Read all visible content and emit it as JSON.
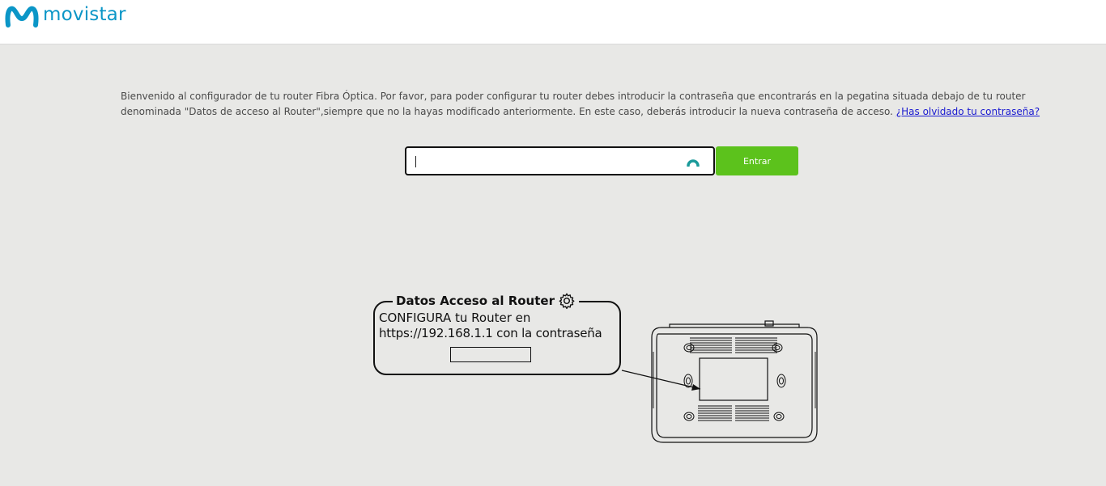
{
  "header": {
    "brand": "movistar",
    "brand_color": "#0b96c7"
  },
  "intro": {
    "text": "Bienvenido al configurador de tu router Fibra Óptica. Por favor, para poder configurar tu router debes introducir la contraseña que encontrarás en la pegatina situada debajo de tu router denominada \"Datos de acceso al Router\",siempre que no la hayas modificado anteriormente. En este caso, deberás introducir la nueva contraseña de acceso.",
    "forgot_link": "¿Has olvidado tu contraseña?"
  },
  "login": {
    "password_value": "",
    "submit_label": "Entrar",
    "submit_color": "#5cc21c"
  },
  "sticker": {
    "title": "Datos Acceso al Router",
    "line1": "CONFIGURA tu Router en",
    "line2": "https://192.168.1.1 con la contraseña"
  },
  "icons": {
    "password_manager": "pw-manager-icon",
    "settings": "gear-icon"
  }
}
